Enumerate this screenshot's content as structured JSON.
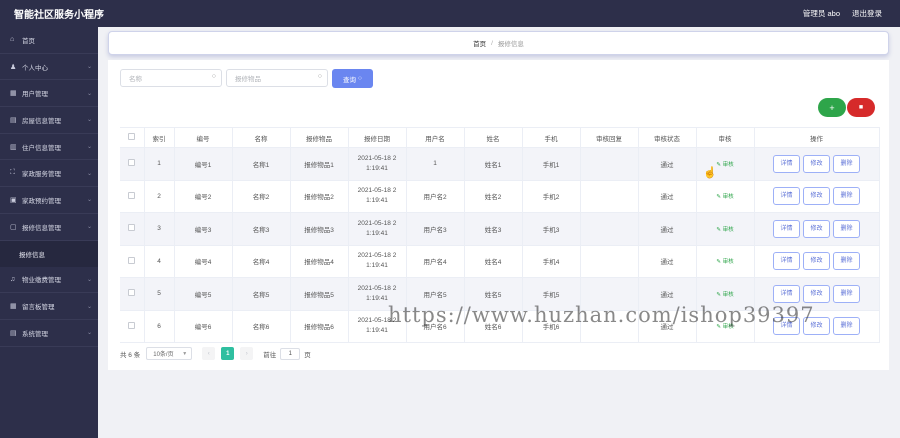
{
  "app": {
    "title": "智能社区服务小程序",
    "user_label": "管理员 abo",
    "logout_label": "退出登录"
  },
  "sidebar": {
    "items": [
      {
        "label": "首页",
        "icon": "home-icon",
        "glyph": "⌂"
      },
      {
        "label": "个人中心",
        "icon": "user-icon",
        "glyph": "♟"
      },
      {
        "label": "用户管理",
        "icon": "grid-icon",
        "glyph": "▦"
      },
      {
        "label": "房屋信息管理",
        "icon": "doc-icon",
        "glyph": "▤"
      },
      {
        "label": "住户信息管理",
        "icon": "columns-icon",
        "glyph": "▥"
      },
      {
        "label": "家政服务管理",
        "icon": "expand-icon",
        "glyph": "⛶"
      },
      {
        "label": "家政预约管理",
        "icon": "calendar-icon",
        "glyph": "▣"
      },
      {
        "label": "报修信息管理",
        "icon": "wrench-icon",
        "glyph": "▢"
      },
      {
        "label": "物业缴费管理",
        "icon": "bell-icon",
        "glyph": "♫"
      },
      {
        "label": "留言板管理",
        "icon": "message-icon",
        "glyph": "▦"
      },
      {
        "label": "系统管理",
        "icon": "settings-icon",
        "glyph": "▤"
      }
    ],
    "submenu": {
      "label": "报修信息"
    }
  },
  "breadcrumb": {
    "home": "首页",
    "separator": "/",
    "current": "报修信息"
  },
  "search": {
    "name_placeholder": "名称",
    "item_placeholder": "报修物品",
    "query_label": "查询"
  },
  "actions": {
    "add_symbol": "+",
    "delete_symbol": "🗑"
  },
  "table": {
    "headers": [
      "",
      "索引",
      "编号",
      "名称",
      "报修物品",
      "报修日期",
      "用户名",
      "姓名",
      "手机",
      "审核回复",
      "审核状态",
      "审核",
      "操作"
    ],
    "audit_label": "审核",
    "btn_detail": "详情",
    "btn_edit": "修改",
    "btn_delete": "删除",
    "rows": [
      {
        "index": "1",
        "code": "编号1",
        "name": "名称1",
        "item": "报修物品1",
        "date1": "2021-05-18 2",
        "date2": "1:19:41",
        "username": "1",
        "realname": "姓名1",
        "phone": "手机1",
        "reply": "",
        "status": "通过"
      },
      {
        "index": "2",
        "code": "编号2",
        "name": "名称2",
        "item": "报修物品2",
        "date1": "2021-05-18 2",
        "date2": "1:19:41",
        "username": "用户名2",
        "realname": "姓名2",
        "phone": "手机2",
        "reply": "",
        "status": "通过"
      },
      {
        "index": "3",
        "code": "编号3",
        "name": "名称3",
        "item": "报修物品3",
        "date1": "2021-05-18 2",
        "date2": "1:19:41",
        "username": "用户名3",
        "realname": "姓名3",
        "phone": "手机3",
        "reply": "",
        "status": "通过"
      },
      {
        "index": "4",
        "code": "编号4",
        "name": "名称4",
        "item": "报修物品4",
        "date1": "2021-05-18 2",
        "date2": "1:19:41",
        "username": "用户名4",
        "realname": "姓名4",
        "phone": "手机4",
        "reply": "",
        "status": "通过"
      },
      {
        "index": "5",
        "code": "编号5",
        "name": "名称5",
        "item": "报修物品5",
        "date1": "2021-05-18 2",
        "date2": "1:19:41",
        "username": "用户名5",
        "realname": "姓名5",
        "phone": "手机5",
        "reply": "",
        "status": "通过"
      },
      {
        "index": "6",
        "code": "编号6",
        "name": "名称6",
        "item": "报修物品6",
        "date1": "2021-05-18 2",
        "date2": "1:19:41",
        "username": "用户名6",
        "realname": "姓名6",
        "phone": "手机6",
        "reply": "",
        "status": "通过"
      }
    ]
  },
  "pagination": {
    "total": "共 6 条",
    "page_size": "10条/页",
    "prev": "‹",
    "current_page": "1",
    "next": "›",
    "goto_label": "前往",
    "goto_value": "1",
    "page_suffix": "页"
  },
  "watermark": "https://www.huzhan.com/ishop39397",
  "colors": {
    "sidebar_bg": "#2d2f4a",
    "primary": "#6a86f0",
    "success": "#2ea54a",
    "danger": "#d62a2a",
    "pager_active": "#2fbfa0"
  }
}
